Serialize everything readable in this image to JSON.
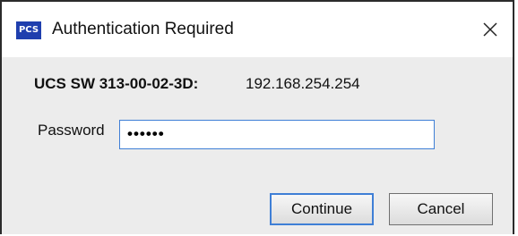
{
  "window": {
    "app_icon_text": "PCS",
    "title": "Authentication Required",
    "close_icon": "close-icon"
  },
  "device": {
    "label": "UCS SW 313-00-02-3D:",
    "address": "192.168.254.254"
  },
  "password": {
    "label": "Password",
    "value": "••••••"
  },
  "buttons": {
    "continue_label": "Continue",
    "cancel_label": "Cancel"
  },
  "colors": {
    "app_icon_bg": "#1f3fae",
    "focus_border": "#3f7fd6"
  }
}
